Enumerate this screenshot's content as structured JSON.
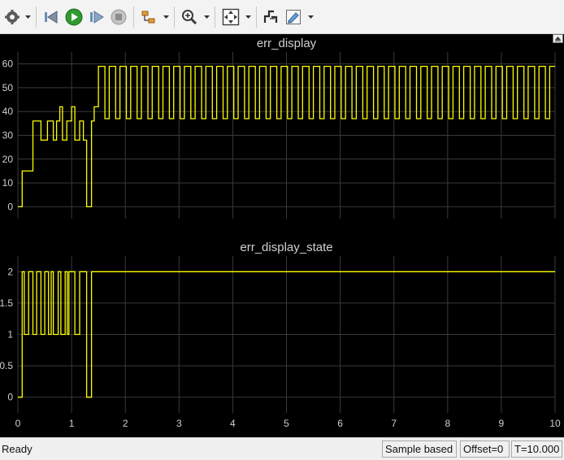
{
  "toolbar": {
    "buttons": [
      {
        "name": "settings-icon"
      },
      {
        "name": "step-back-icon"
      },
      {
        "name": "run-icon"
      },
      {
        "name": "step-forward-icon"
      },
      {
        "name": "stop-icon"
      },
      {
        "name": "signal-selector-icon"
      },
      {
        "name": "zoom-in-icon"
      },
      {
        "name": "autoscale-icon"
      },
      {
        "name": "cursor-measure-icon"
      },
      {
        "name": "highlight-pen-icon"
      }
    ]
  },
  "colors": {
    "background": "#000000",
    "grid": "#3a3a3a",
    "axis_text": "#d0d0d0",
    "signal": "#ffff00"
  },
  "chart_data": [
    {
      "type": "line",
      "title": "err_display",
      "xlim": [
        0,
        10
      ],
      "ylim": [
        -5,
        65
      ],
      "yticks": [
        0,
        10,
        20,
        30,
        40,
        50,
        60
      ],
      "xticks": [
        0,
        1,
        2,
        3,
        4,
        5,
        6,
        7,
        8,
        9,
        10
      ],
      "x_tick_labels_shown": false,
      "grid": true,
      "series": [
        {
          "step_points": [
            [
              0,
              0
            ],
            [
              0.08,
              15
            ],
            [
              0.28,
              36
            ],
            [
              0.43,
              28
            ],
            [
              0.55,
              36
            ],
            [
              0.66,
              28
            ],
            [
              0.72,
              36
            ],
            [
              0.78,
              42
            ],
            [
              0.83,
              28
            ],
            [
              0.91,
              36
            ],
            [
              1.0,
              42
            ],
            [
              1.06,
              28
            ],
            [
              1.15,
              36
            ],
            [
              1.22,
              28
            ],
            [
              1.28,
              0
            ],
            [
              1.37,
              36
            ],
            [
              1.42,
              42
            ],
            [
              1.5,
              59
            ],
            [
              1.62,
              37
            ],
            [
              1.7,
              59
            ],
            [
              1.82,
              37
            ],
            [
              1.9,
              59
            ],
            [
              2.02,
              37
            ]
          ],
          "periodic_after": {
            "start": 1.5,
            "end": 10,
            "period": 0.2,
            "high": 59,
            "high_duration": 0.12,
            "low": 37
          }
        }
      ]
    },
    {
      "type": "line",
      "title": "err_display_state",
      "xlim": [
        0,
        10
      ],
      "ylim": [
        -0.25,
        2.25
      ],
      "yticks": [
        0,
        0.5,
        1,
        1.5,
        2
      ],
      "ytick_labels": [
        "0",
        "0.5",
        "1",
        "1.5",
        "2"
      ],
      "xticks": [
        0,
        1,
        2,
        3,
        4,
        5,
        6,
        7,
        8,
        9,
        10
      ],
      "grid": true,
      "series": [
        {
          "step_points": [
            [
              0,
              0
            ],
            [
              0.08,
              2
            ],
            [
              0.12,
              1
            ],
            [
              0.2,
              2
            ],
            [
              0.28,
              1
            ],
            [
              0.35,
              2
            ],
            [
              0.43,
              1
            ],
            [
              0.5,
              2
            ],
            [
              0.57,
              1
            ],
            [
              0.62,
              2
            ],
            [
              0.66,
              1
            ],
            [
              0.75,
              2
            ],
            [
              0.8,
              1
            ],
            [
              0.88,
              2
            ],
            [
              0.92,
              1
            ],
            [
              0.95,
              2
            ],
            [
              1.06,
              1
            ],
            [
              1.15,
              2
            ],
            [
              1.28,
              0
            ],
            [
              1.37,
              2
            ],
            [
              10,
              2
            ]
          ]
        }
      ]
    }
  ],
  "status": {
    "ready": "Ready",
    "sample_mode": "Sample based",
    "offset": "Offset=0",
    "time": "T=10.000"
  }
}
